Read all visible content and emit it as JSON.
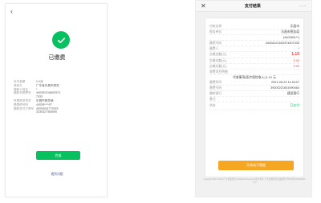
{
  "left": {
    "back_icon": "‹",
    "title": "已缴费",
    "rows": [
      {
        "k": "支付金额",
        "v": "1.1元"
      },
      {
        "k": "收款方",
        "v": "广东省乐昌市税务"
      },
      {
        "k": "缴款人姓名",
        "v": "*"
      },
      {
        "k": "缴款书税票号",
        "v": "440281216600374"
      },
      {
        "k": "",
        "v": "7333"
      },
      {
        "k": "",
        "v": ""
      },
      {
        "k": "所属税务机关",
        "v": "乐昌市税务局"
      },
      {
        "k": "缴费税号码",
        "v": "44028****97"
      },
      {
        "k": "缴款支付订单号",
        "v": "42000011772022"
      },
      {
        "k": "",
        "v": "3230327300000"
      }
    ],
    "button": "完成",
    "link": "遇到问题"
  },
  "right": {
    "header": {
      "close": "✕",
      "title": "支付结果",
      "more": "···"
    },
    "rows": [
      {
        "k": "付款名称",
        "v": "乐昌市",
        "cls": ""
      },
      {
        "k": "税务单位",
        "v": "乐昌市税务局",
        "cls": ""
      },
      {
        "k": "",
        "v": "(4402811**)",
        "cls": ""
      },
      {
        "k": "缴税号码",
        "v": "44028121600374407333",
        "cls": ""
      },
      {
        "k": "缴费人",
        "v": "*",
        "cls": ""
      },
      {
        "k": "应缴金额(元)",
        "v": "1.10",
        "cls": "red big"
      },
      {
        "k": "实缴金额(元)",
        "v": "0.00",
        "cls": "red"
      },
      {
        "k": "应缴总额(元)",
        "v": "0.00",
        "cls": "red"
      },
      {
        "k": "收费项目明细",
        "v": "",
        "cls": ""
      },
      {
        "k": "",
        "v": "代收事项(医疗保险收入):1.10 元",
        "cls": "center"
      },
      {
        "k": "缴费时间",
        "v": "2021-06-22 11:45:07",
        "cls": ""
      },
      {
        "k": "缴费号码",
        "v": "39200221601090464",
        "cls": ""
      },
      {
        "k": "缴款银行",
        "v": "建设银行",
        "cls": ""
      },
      {
        "k": "备注",
        "v": "",
        "cls": ""
      },
      {
        "k": "状态",
        "v": "已支付",
        "cls": "green tall"
      }
    ],
    "button": "开具电子票据",
    "footer": "Copyright 2017-2021 广东省税务局 All Rights Reserved 技术支持: 广东省税务局 版权所有 粤ICP备 000000000号-0"
  }
}
